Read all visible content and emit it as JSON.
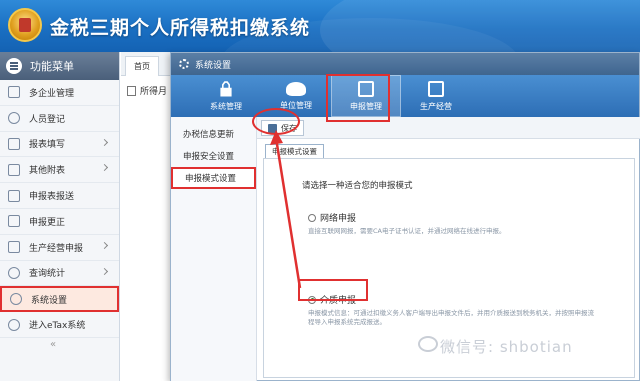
{
  "app": {
    "title": "金税三期个人所得税扣缴系统"
  },
  "sidebar": {
    "header": "功能菜单",
    "items": [
      {
        "label": "多企业管理"
      },
      {
        "label": "人员登记"
      },
      {
        "label": "报表填写"
      },
      {
        "label": "其他附表"
      },
      {
        "label": "申报表报送"
      },
      {
        "label": "申报更正"
      },
      {
        "label": "生产经营申报"
      },
      {
        "label": "查询统计"
      },
      {
        "label": "系统设置"
      },
      {
        "label": "进入eTax系统"
      }
    ],
    "collapse": "«"
  },
  "tabs": {
    "home": "首页",
    "sub": "所得月"
  },
  "dialog": {
    "title": "系统设置",
    "toolbar": [
      {
        "label": "系统管理"
      },
      {
        "label": "单位管理"
      },
      {
        "label": "申报管理"
      },
      {
        "label": "生产经营"
      }
    ],
    "left_items": [
      {
        "label": "办税信息更新"
      },
      {
        "label": "申报安全设置"
      },
      {
        "label": "申报模式设置"
      }
    ],
    "save": "保存",
    "content_tab": "申报模式设置",
    "prompt": "请选择一种适合您的申报模式",
    "options": [
      {
        "label": "网络申报",
        "desc": "直接互联网网报，需要CA电子证书认证，并通过网络在线进行申报。",
        "selected": false
      },
      {
        "label": "介质申报",
        "desc": "申报模式信息：可通过扣缴义务人客户端导出申报文件后，并用介质报送到税务机关，并按照申报流程导入申报系统完成报送。",
        "selected": true
      }
    ]
  },
  "watermark": "微信号: shbotian"
}
